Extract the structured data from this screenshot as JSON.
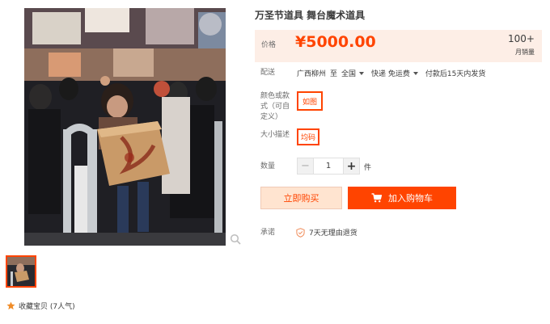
{
  "product": {
    "title": "万圣节道具 舞台魔术道具"
  },
  "price": {
    "label": "价格",
    "value": "¥5000.00",
    "sales_count": "100+",
    "sales_label": "月销量"
  },
  "shipping": {
    "label": "配送",
    "from": "广西柳州",
    "to_word": "至",
    "to": "全国",
    "method": "快递 免运费",
    "dispatch": "付款后15天内发货"
  },
  "options": {
    "color_label": "颜色或款式（可自定义）",
    "color_value": "如图",
    "size_label": "大小描述",
    "size_value": "均码"
  },
  "quantity": {
    "label": "数量",
    "minus": "−",
    "value": "1",
    "plus": "+",
    "unit": "件"
  },
  "actions": {
    "buy_now": "立即购买",
    "add_to_cart": "加入购物车"
  },
  "promise": {
    "label": "承诺",
    "text": "7天无理由退货"
  },
  "favorite": {
    "text": "收藏宝贝 (7人气)"
  },
  "colors": {
    "accent": "#ff4400",
    "price_bg": "#fdeee6",
    "buy_now_bg": "#ffe4d0"
  },
  "icons": [
    "zoom-icon",
    "cart-icon",
    "shield-check-icon",
    "star-icon"
  ]
}
